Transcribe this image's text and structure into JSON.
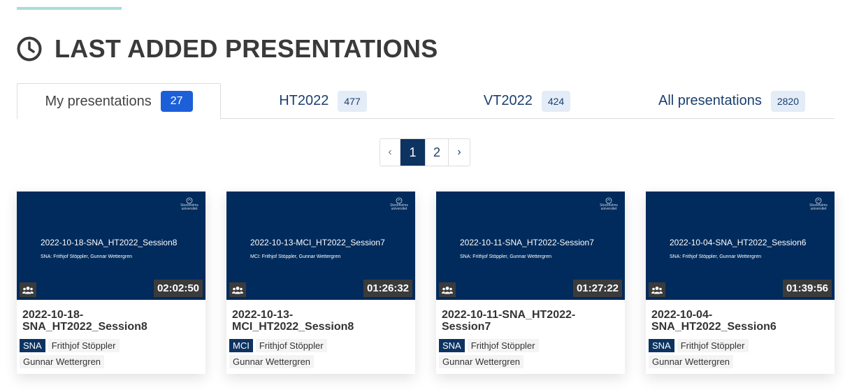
{
  "heading": {
    "title": "LAST ADDED PRESENTATIONS",
    "icon": "clock-icon"
  },
  "tabs": [
    {
      "label": "My presentations",
      "count": "27",
      "active": true
    },
    {
      "label": "HT2022",
      "count": "477",
      "active": false
    },
    {
      "label": "VT2022",
      "count": "424",
      "active": false
    },
    {
      "label": "All presentations",
      "count": "2820",
      "active": false
    }
  ],
  "pagination": {
    "prev": "‹",
    "pages": [
      "1",
      "2"
    ],
    "current": "1",
    "next": "›"
  },
  "cards": [
    {
      "slide_title": "2022-10-18-SNA_HT2022_Session8",
      "slide_subtitle": "SNA: Frithjof Stöppler, Gunnar Wettergren",
      "duration": "02:02:50",
      "title": "2022-10-18-SNA_HT2022_Session8",
      "course": "SNA",
      "presenters": [
        "Frithjof Stöppler",
        "Gunnar Wettergren"
      ]
    },
    {
      "slide_title": "2022-10-13-MCI_HT2022_Session7",
      "slide_subtitle": "MCI: Frithjof Stöppler, Gunnar Wettergren",
      "duration": "01:26:32",
      "title": "2022-10-13-MCI_HT2022_Session8",
      "course": "MCI",
      "presenters": [
        "Frithjof Stöppler",
        "Gunnar Wettergren"
      ]
    },
    {
      "slide_title": "2022-10-11-SNA_HT2022-Session7",
      "slide_subtitle": "SNA: Frithjof Stöppler, Gunnar Wettergren",
      "duration": "01:27:22",
      "title": "2022-10-11-SNA_HT2022-Session7",
      "course": "SNA",
      "presenters": [
        "Frithjof Stöppler",
        "Gunnar Wettergren"
      ]
    },
    {
      "slide_title": "2022-10-04-SNA_HT2022_Session6",
      "slide_subtitle": "SNA: Frithjof Stöppler, Gunnar Wettergren",
      "duration": "01:39:56",
      "title": "2022-10-04-SNA_HT2022_Session6",
      "course": "SNA",
      "presenters": [
        "Frithjof Stöppler",
        "Gunnar Wettergren"
      ]
    }
  ],
  "logo_text": [
    "Stockholms",
    "universitet"
  ],
  "colors": {
    "accent": "#a8dcd9",
    "brand_navy": "#002b5c",
    "active_badge": "#1c5fd8",
    "link": "#1c3f6e"
  }
}
